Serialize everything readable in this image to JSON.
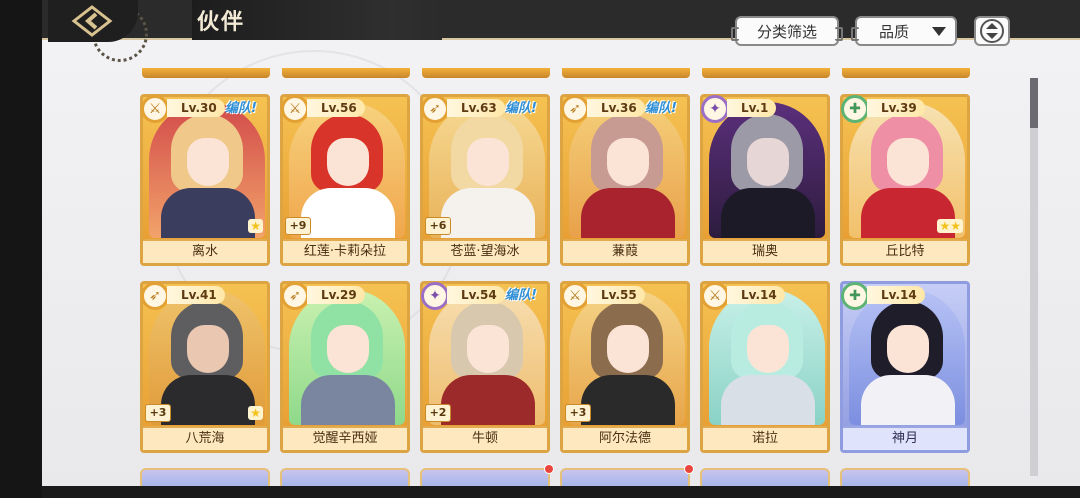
{
  "header": {
    "title": "伙伴",
    "filter_label": "分类筛选",
    "quality_label": "品质"
  },
  "colors": {
    "card_gold": "#f2b03a",
    "card_purple": "#a7b0ea",
    "team_tag": "#2f8fd6"
  },
  "partners": [
    {
      "name": "离水",
      "level": "Lv.30",
      "team": "编队!",
      "plus": "",
      "stars": "★",
      "class_icon": "sword-icon"
    },
    {
      "name": "红莲·卡莉朵拉",
      "level": "Lv.56",
      "team": "",
      "plus": "+9",
      "stars": "",
      "class_icon": "sword-icon"
    },
    {
      "name": "苍蓝·望海冰",
      "level": "Lv.63",
      "team": "编队!",
      "plus": "+6",
      "stars": "",
      "class_icon": "bow-icon"
    },
    {
      "name": "蒹葭",
      "level": "Lv.36",
      "team": "编队!",
      "plus": "",
      "stars": "",
      "class_icon": "bow-icon"
    },
    {
      "name": "瑞奥",
      "level": "Lv.1",
      "team": "",
      "plus": "",
      "stars": "",
      "class_icon": "magic-icon"
    },
    {
      "name": "丘比特",
      "level": "Lv.39",
      "team": "",
      "plus": "",
      "stars": "★★",
      "class_icon": "heal-icon"
    },
    {
      "name": "八荒海",
      "level": "Lv.41",
      "team": "",
      "plus": "+3",
      "stars": "★",
      "class_icon": "bow-icon"
    },
    {
      "name": "觉醒辛西娅",
      "level": "Lv.29",
      "team": "",
      "plus": "",
      "stars": "",
      "class_icon": "bow-icon"
    },
    {
      "name": "牛顿",
      "level": "Lv.54",
      "team": "编队!",
      "plus": "+2",
      "stars": "",
      "class_icon": "magic-icon"
    },
    {
      "name": "阿尔法德",
      "level": "Lv.55",
      "team": "",
      "plus": "+3",
      "stars": "",
      "class_icon": "sword-icon"
    },
    {
      "name": "诺拉",
      "level": "Lv.14",
      "team": "",
      "plus": "",
      "stars": "",
      "class_icon": "sword-icon"
    },
    {
      "name": "神月",
      "level": "Lv.14",
      "team": "",
      "plus": "",
      "stars": "",
      "class_icon": "heal-icon"
    }
  ]
}
